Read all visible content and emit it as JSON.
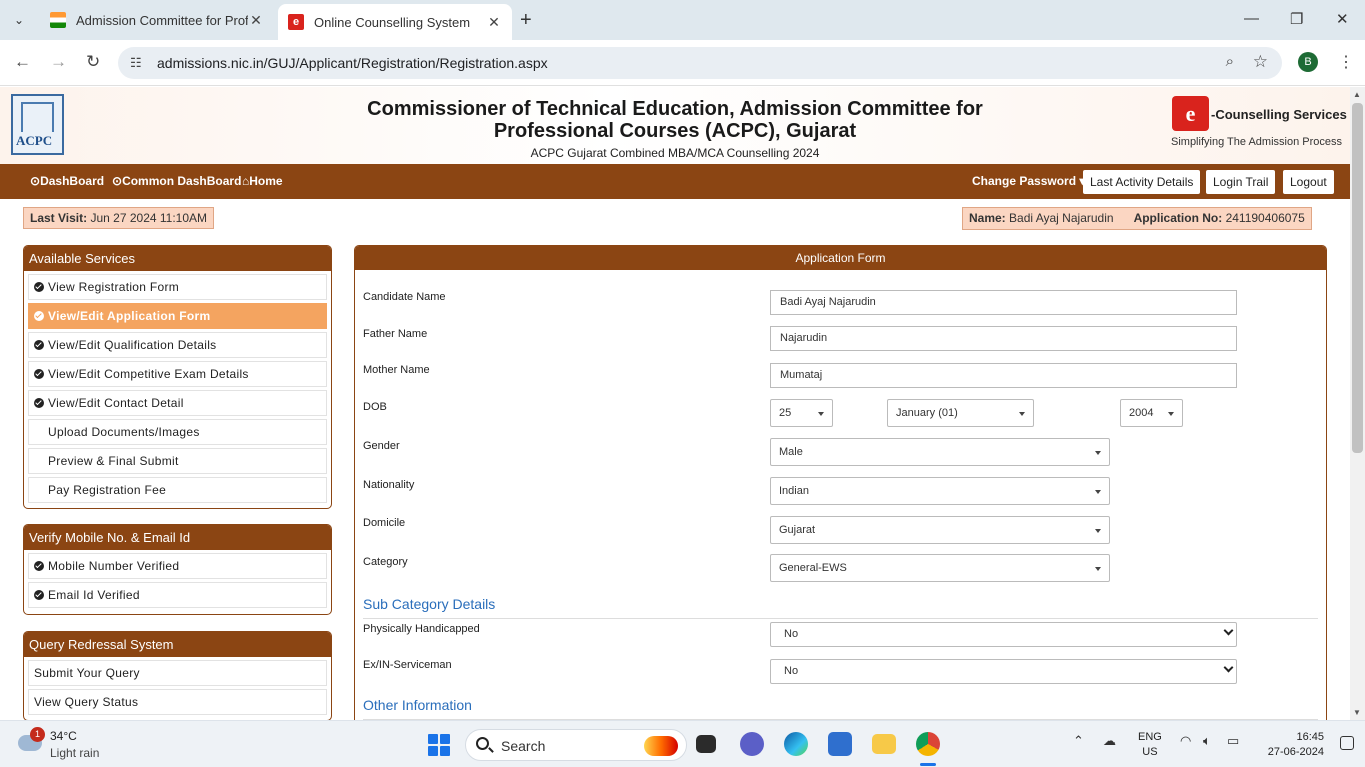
{
  "browser": {
    "tabs": [
      {
        "title": "Admission Committee for Profe",
        "active": false
      },
      {
        "title": "Online Counselling System",
        "active": true
      }
    ],
    "url": "admissions.nic.in/GUJ/Applicant/Registration/Registration.aspx",
    "profile_initial": "B"
  },
  "header": {
    "logo_text": "ACPC",
    "title_line1": "Commissioner of Technical Education, Admission Committee for",
    "title_line2": "Professional Courses (ACPC), Gujarat",
    "subtitle": "ACPC Gujarat Combined MBA/MCA Counselling 2024",
    "brand_name": "-Counselling Services",
    "brand_tagline": "Simplifying The Admission Process",
    "brand_logo": "e"
  },
  "nav": {
    "dashboard": "DashBoard",
    "common_dashboard": "Common DashBoard",
    "home": "Home",
    "change_password": "Change Password",
    "last_activity": "Last Activity Details",
    "login_trail": "Login Trail",
    "logout": "Logout"
  },
  "info": {
    "last_visit_label": "Last Visit:",
    "last_visit_value": "Jun 27 2024 11:10AM",
    "name_label": "Name:",
    "name_value": "Badi Ayaj Najarudin",
    "appno_label": "Application No:",
    "appno_value": "241190406075"
  },
  "sidebar": {
    "services_title": "Available Services",
    "services": [
      {
        "label": "View Registration Form",
        "icon": "check-circle-icon"
      },
      {
        "label": "View/Edit Application Form",
        "icon": "check-circle-icon",
        "selected": true
      },
      {
        "label": "View/Edit Qualification Details",
        "icon": "check-circle-icon"
      },
      {
        "label": "View/Edit Competitive Exam Details",
        "icon": "check-circle-icon"
      },
      {
        "label": "View/Edit Contact Detail",
        "icon": "check-circle-icon"
      },
      {
        "label": "Upload Documents/Images",
        "icon": "clock-icon"
      },
      {
        "label": "Preview & Final Submit",
        "icon": "clock-icon"
      },
      {
        "label": "Pay Registration Fee",
        "icon": "clock-icon"
      }
    ],
    "verify_title": "Verify Mobile No. & Email Id",
    "verify": [
      {
        "label": "Mobile Number Verified"
      },
      {
        "label": "Email Id Verified"
      }
    ],
    "query_title": "Query Redressal System",
    "query": [
      {
        "label": "Submit Your Query"
      },
      {
        "label": "View Query Status"
      }
    ]
  },
  "form": {
    "title": "Application Form",
    "candidate_name_label": "Candidate Name",
    "candidate_name": "Badi Ayaj Najarudin",
    "father_name_label": "Father Name",
    "father_name": "Najarudin",
    "mother_name_label": "Mother Name",
    "mother_name": "Mumataj",
    "dob_label": "DOB",
    "dob_day": "25",
    "dob_month": "January (01)",
    "dob_year": "2004",
    "gender_label": "Gender",
    "gender": "Male",
    "nationality_label": "Nationality",
    "nationality": "Indian",
    "domicile_label": "Domicile",
    "domicile": "Gujarat",
    "category_label": "Category",
    "category": "General-EWS",
    "subcategory_heading": "Sub Category Details",
    "ph_label": "Physically Handicapped",
    "ph_value": "No",
    "serviceman_label": "Ex/IN-Serviceman",
    "serviceman_value": "No",
    "other_heading": "Other Information"
  },
  "taskbar": {
    "weather_badge": "1",
    "temperature": "34°C",
    "weather_desc": "Light rain",
    "search_placeholder": "Search",
    "lang_line1": "ENG",
    "lang_line2": "US",
    "time": "16:45",
    "date": "27-06-2024"
  },
  "colors": {
    "brand_brown": "#8b4513",
    "selected_orange": "#f4a460",
    "info_peach": "#fbd6c2",
    "section_blue": "#2a6ebb"
  }
}
